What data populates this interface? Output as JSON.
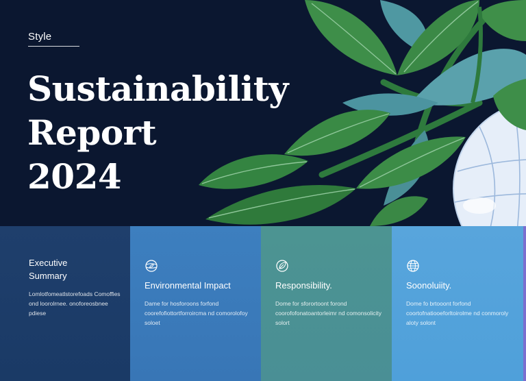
{
  "hero": {
    "eyebrow": "Style",
    "title_lines": [
      "Sustainability",
      "Report",
      "2024"
    ]
  },
  "cards": [
    {
      "title": "Executive Summary",
      "body": "Lomlotfomeatlstorefoads Comoffies ond loorolrnee. onoforeosbnee pdiese",
      "icon": "",
      "color": "#1f3f6c"
    },
    {
      "title": "Environmental Impact",
      "body": "Dame for hosforoons forfond coorefofiottortforroircma nd comorolofoy soloet",
      "icon": "globe-leaf-icon",
      "color": "#3d7fbf"
    },
    {
      "title": "Responsibility.",
      "body": "Dome for sforortoont forond coorofofonatoantorleimr nd comonsolicity solort",
      "icon": "leaf-icon",
      "color": "#4c9492"
    },
    {
      "title": "Soonoluiity.",
      "body": "Dome fo brtooont forfond coortofnatiooeforltoirolme nd conmoroly aloty solont",
      "icon": "globe-icon",
      "color": "#58a5dc"
    }
  ],
  "palette": {
    "background": "#0b1730",
    "leaf_dark": "#2f7a3b",
    "leaf_mid": "#3f9149",
    "leaf_light": "#4f9d55",
    "teal_leaf": "#4e9aa6",
    "globe": "#e8f1fb"
  }
}
